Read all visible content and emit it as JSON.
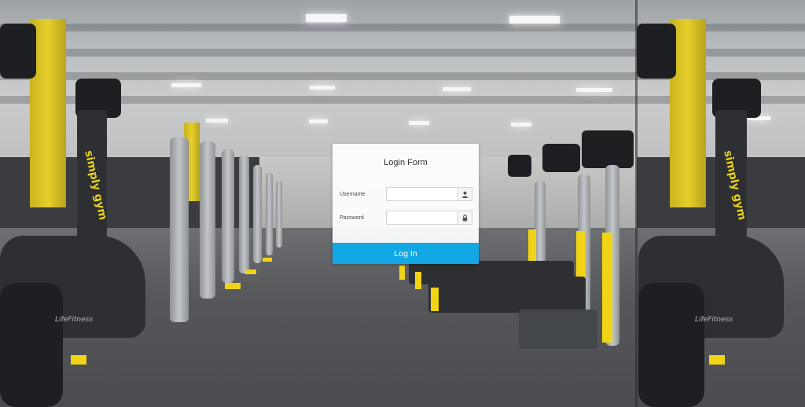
{
  "login_form": {
    "title": "Login Form",
    "username_label": "Username",
    "username_value": "",
    "password_label": "Password",
    "password_value": "",
    "submit_label": "Log In",
    "username_icon": "user-icon",
    "password_icon": "lock-icon",
    "button_color": "#12a8e6"
  },
  "background": {
    "brand_text": "simply gym",
    "equipment_brand": "LifeFitness",
    "accent_color": "#f1d416"
  }
}
